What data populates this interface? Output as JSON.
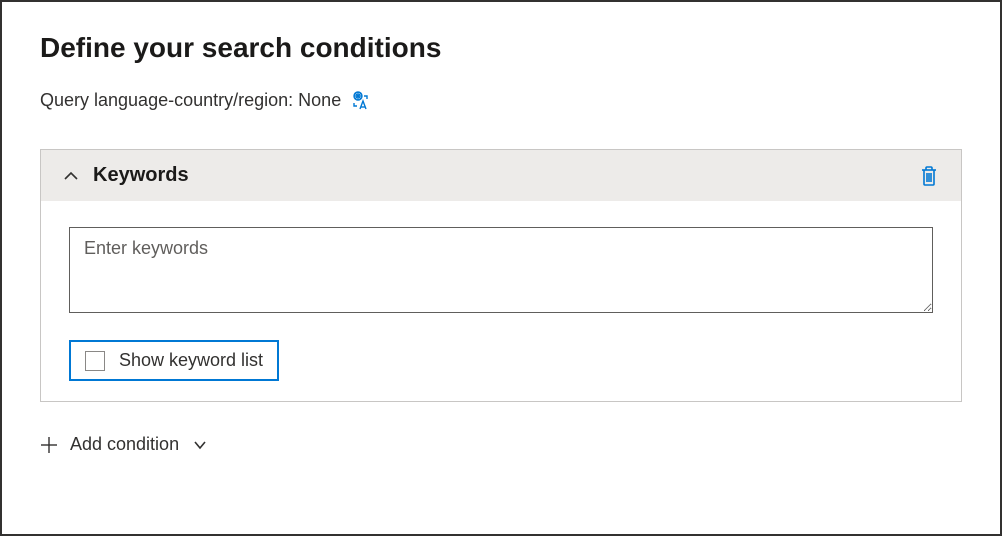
{
  "header": {
    "title": "Define your search conditions"
  },
  "query_language": {
    "label": "Query language-country/region:",
    "value": "None"
  },
  "condition": {
    "title": "Keywords",
    "textarea_placeholder": "Enter keywords",
    "textarea_value": "",
    "show_keyword_list_label": "Show keyword list"
  },
  "add_condition": {
    "label": "Add condition"
  }
}
